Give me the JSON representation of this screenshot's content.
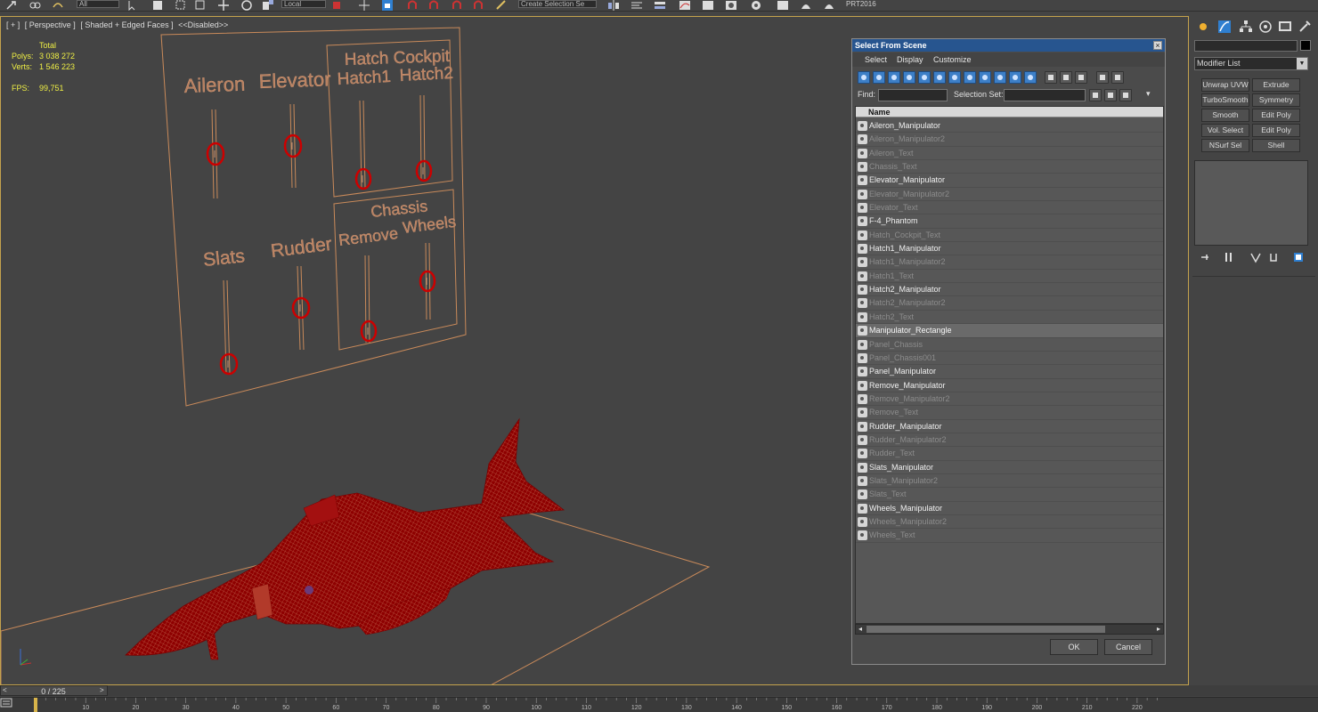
{
  "toolbar": {
    "selection_filter": "All",
    "coordinate_system": "Local",
    "named_selection_placeholder": "Create Selection Se",
    "prt_label": "PRT2016"
  },
  "viewport": {
    "labels": [
      "[ + ]",
      "[ Perspective ]",
      "[ Shaded + Edged Faces ]",
      "<<Disabled>>"
    ],
    "stats": {
      "total_label": "Total",
      "polys_label": "Polys:",
      "polys_value": "3 038 272",
      "verts_label": "Verts:",
      "verts_value": "1 546 223",
      "fps_label": "FPS:",
      "fps_value": "99,751"
    },
    "panel_texts": {
      "aileron": "Aileron",
      "elevator": "Elevator",
      "hatch_cockpit": "Hatch Cockpit",
      "hatch1": "Hatch1",
      "hatch2": "Hatch2",
      "slats": "Slats",
      "rudder": "Rudder",
      "chassis": "Chassis",
      "remove": "Remove",
      "wheels": "Wheels"
    },
    "wire_color": "#c98a5a",
    "mesh_color": "#9b0000"
  },
  "dialog": {
    "title": "Select From Scene",
    "close_glyph": "×",
    "menu": [
      "Select",
      "Display",
      "Customize"
    ],
    "find_label": "Find:",
    "selection_set_label": "Selection Set:",
    "column_header": "Name",
    "objects": [
      {
        "name": "Aileron_Manipulator",
        "hidden": false
      },
      {
        "name": "Aileron_Manipulator2",
        "hidden": true
      },
      {
        "name": "Aileron_Text",
        "hidden": true
      },
      {
        "name": "Chassis_Text",
        "hidden": true
      },
      {
        "name": "Elevator_Manipulator",
        "hidden": false
      },
      {
        "name": "Elevator_Manipulator2",
        "hidden": true
      },
      {
        "name": "Elevator_Text",
        "hidden": true
      },
      {
        "name": "F-4_Phantom",
        "hidden": false
      },
      {
        "name": "Hatch_Cockpit_Text",
        "hidden": true
      },
      {
        "name": "Hatch1_Manipulator",
        "hidden": false
      },
      {
        "name": "Hatch1_Manipulator2",
        "hidden": true
      },
      {
        "name": "Hatch1_Text",
        "hidden": true
      },
      {
        "name": "Hatch2_Manipulator",
        "hidden": false
      },
      {
        "name": "Hatch2_Manipulator2",
        "hidden": true
      },
      {
        "name": "Hatch2_Text",
        "hidden": true
      },
      {
        "name": "Manipulator_Rectangle",
        "hidden": false,
        "selected": true
      },
      {
        "name": "Panel_Chassis",
        "hidden": true
      },
      {
        "name": "Panel_Chassis001",
        "hidden": true
      },
      {
        "name": "Panel_Manipulator",
        "hidden": false
      },
      {
        "name": "Remove_Manipulator",
        "hidden": false
      },
      {
        "name": "Remove_Manipulator2",
        "hidden": true
      },
      {
        "name": "Remove_Text",
        "hidden": true
      },
      {
        "name": "Rudder_Manipulator",
        "hidden": false
      },
      {
        "name": "Rudder_Manipulator2",
        "hidden": true
      },
      {
        "name": "Rudder_Text",
        "hidden": true
      },
      {
        "name": "Slats_Manipulator",
        "hidden": false
      },
      {
        "name": "Slats_Manipulator2",
        "hidden": true
      },
      {
        "name": "Slats_Text",
        "hidden": true
      },
      {
        "name": "Wheels_Manipulator",
        "hidden": false
      },
      {
        "name": "Wheels_Manipulator2",
        "hidden": true
      },
      {
        "name": "Wheels_Text",
        "hidden": true
      }
    ],
    "ok_label": "OK",
    "cancel_label": "Cancel",
    "title_color": "#27558f"
  },
  "command_panel": {
    "modifier_list_label": "Modifier List",
    "buttons": [
      "Unwrap UVW",
      "Extrude",
      "TurboSmooth",
      "Symmetry",
      "Smooth",
      "Edit Poly",
      "Vol. Select",
      "Edit Poly",
      "NSurf Sel",
      "Shell"
    ]
  },
  "timeline": {
    "frame_display": "0 / 225",
    "prev_glyph": "<",
    "next_glyph": ">",
    "ruler_labels": [
      "10",
      "20",
      "30",
      "40",
      "50",
      "60",
      "70",
      "80",
      "90",
      "100",
      "110",
      "120",
      "130",
      "140",
      "150",
      "160",
      "170",
      "180",
      "190",
      "200",
      "210",
      "220"
    ]
  }
}
